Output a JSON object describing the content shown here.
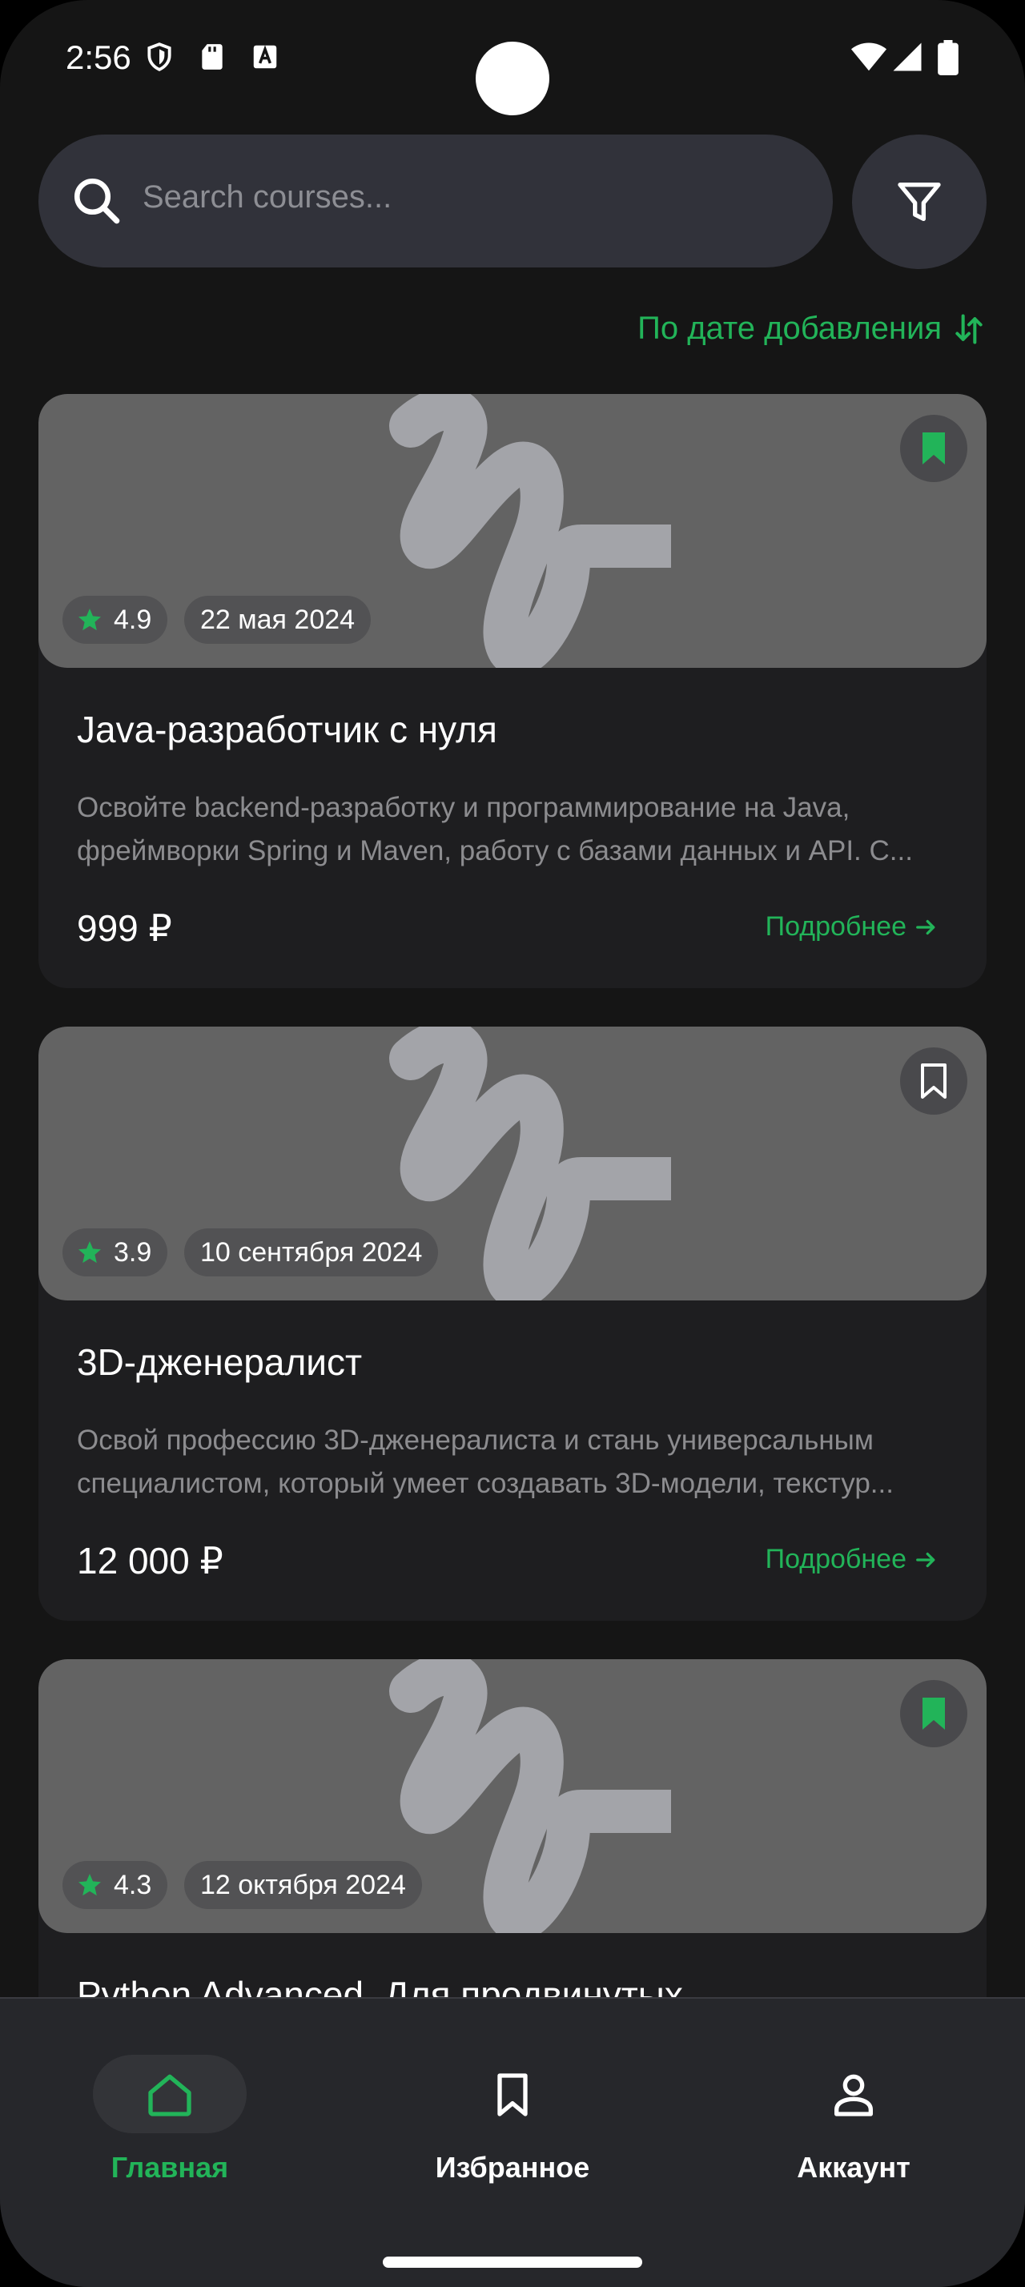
{
  "status_bar": {
    "time": "2:56",
    "icons": [
      "shield-icon",
      "sd-card-icon",
      "keyboard-a-icon",
      "wifi-icon",
      "signal-icon",
      "battery-icon"
    ]
  },
  "search": {
    "placeholder": "Search courses..."
  },
  "sort": {
    "label": "По дате добавления"
  },
  "colors": {
    "accent": "#22b459",
    "background": "#151515",
    "card": "#1e1e20"
  },
  "courses": [
    {
      "title": "Java-разработчик с нуля",
      "description": "Освойте backend-разработку и программирование на Java, фреймворки Spring и Maven, работу с базами данных и API. C...",
      "price": "999 ₽",
      "rating": "4.9",
      "date": "22 мая 2024",
      "bookmarked": true,
      "more_label": "Подробнее"
    },
    {
      "title": "3D-дженералист",
      "description": "Освой профессию 3D-дженералиста и стань универсальным специалистом, который умеет создавать 3D-модели, текстур...",
      "price": "12 000 ₽",
      "rating": "3.9",
      "date": "10 сентября 2024",
      "bookmarked": false,
      "more_label": "Подробнее"
    },
    {
      "title": "Python Advanced. Для продвинутых",
      "rating": "4.3",
      "date": "12 октября 2024",
      "bookmarked": true
    }
  ],
  "bottom_nav": {
    "items": [
      {
        "label": "Главная",
        "icon": "home-icon",
        "active": true
      },
      {
        "label": "Избранное",
        "icon": "bookmark-icon",
        "active": false
      },
      {
        "label": "Аккаунт",
        "icon": "person-icon",
        "active": false
      }
    ]
  }
}
